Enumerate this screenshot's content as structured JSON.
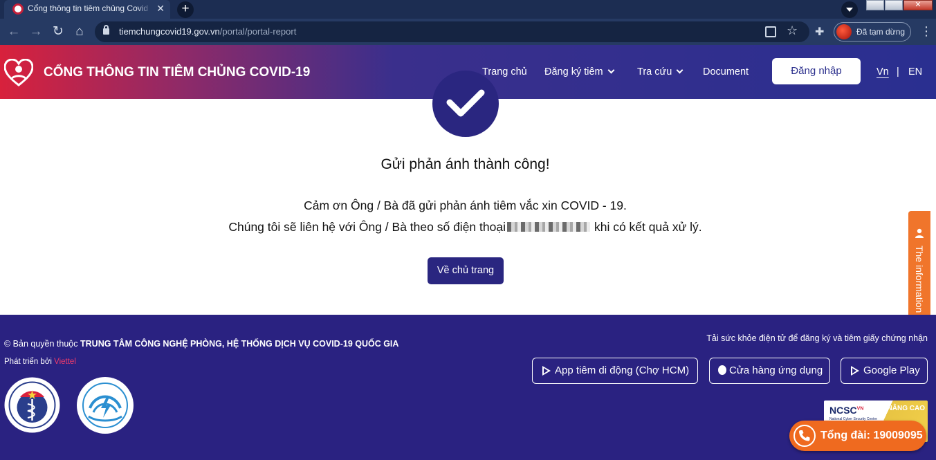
{
  "browser": {
    "tab_title": "Cổng thông tin tiêm chủng Covid",
    "url_domain": "tiemchungcovid19.gov.vn",
    "url_path": "/portal/portal-report",
    "profile_status": "Đã tạm dừng",
    "icons": [
      "back-arrow-icon",
      "forward-arrow-icon",
      "reload-icon",
      "home-icon",
      "lock-icon",
      "translate-icon",
      "star-icon",
      "extensions-icon",
      "menu-icon"
    ]
  },
  "header": {
    "site_title": "CỔNG THÔNG TIN TIÊM CHỦNG COVID-19",
    "nav": {
      "home": "Trang chủ",
      "register": "Đăng ký tiêm",
      "lookup": "Tra cứu",
      "document": "Document"
    },
    "login_label": "Đăng nhập",
    "lang_vn": "Vn",
    "lang_separator": "|",
    "lang_en": "EN"
  },
  "main": {
    "success_title": "Gửi phản ánh thành công!",
    "thanks_message": "Cảm ơn Ông / Bà đã gửi phản ánh tiêm vắc xin COVID - 19.",
    "contact_prefix": "Chúng tôi sẽ liên hệ với Ông / Bà theo số điện thoại",
    "contact_suffix": "khi có kết quả xử lý.",
    "home_button": "Về chủ trang"
  },
  "side_tab": {
    "label": "The information"
  },
  "footer": {
    "copyright_prefix": "© Bản quyền thuộc",
    "copyright_owner": "TRUNG TÂM CÔNG NGHỆ PHÒNG, HỆ THỐNG DỊCH VỤ COVID-19 QUỐC GIA",
    "developed_by_label": "Phát triển bởi",
    "developer": "Viettel",
    "app_note": "Tải sức khỏe điện tử để đăng ký và tiêm giấy chứng nhận",
    "store_buttons": {
      "hcm": "App tiêm di động (Chợ HCM)",
      "apple": "Cửa hàng ứng dụng",
      "google": "Google Play"
    },
    "ncsc_badge": {
      "name": "NCSC",
      "country": "VN",
      "subtitle": "National Cyber Security Centre",
      "level": "NÂNG CAO"
    },
    "hotline": "Tổng đài: 19009095"
  },
  "colors": {
    "primary": "#2a2281",
    "accent_red": "#d8213c",
    "hotline_orange": "#ef6a1f",
    "developer_pink": "#f23b6b"
  }
}
